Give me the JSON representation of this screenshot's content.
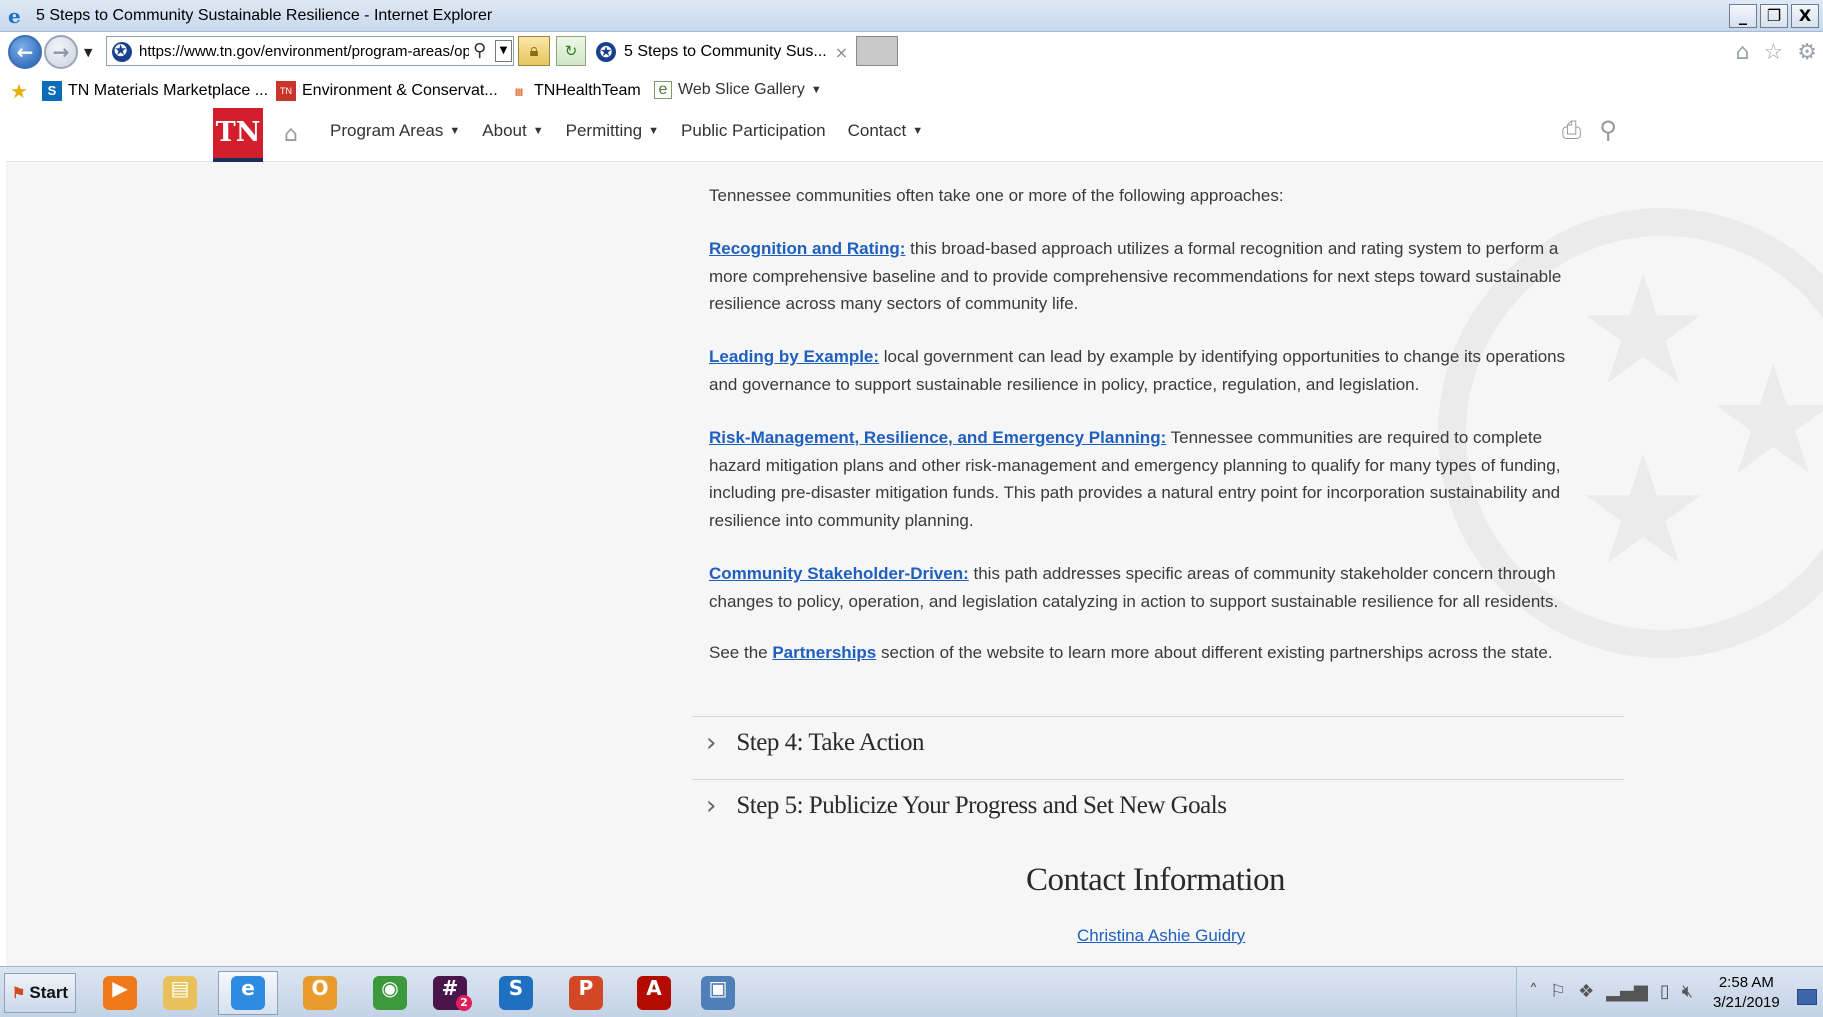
{
  "window": {
    "title": "5 Steps to Community Sustainable Resilience - Internet Explorer",
    "controls": [
      "_",
      "❐",
      "X"
    ]
  },
  "browser": {
    "url": "https://www.tn.gov/environment/program-areas/opsp-policy-and-sustainable-practices",
    "tab_label": "5 Steps to Community Sus...",
    "tab_close": "×"
  },
  "favorites": [
    {
      "label": "TN Materials Marketplace ...",
      "icon": "sp"
    },
    {
      "label": "Environment & Conservat...",
      "icon": "TN"
    },
    {
      "label": "TNHealthTeam",
      "icon": "ıııı"
    },
    {
      "label": "Web Slice Gallery",
      "icon": "e"
    }
  ],
  "site": {
    "logo": "TN",
    "nav": [
      {
        "label": "Program Areas",
        "has_caret": true
      },
      {
        "label": "About",
        "has_caret": true
      },
      {
        "label": "Permitting",
        "has_caret": true
      },
      {
        "label": "Public Participation",
        "has_caret": false
      },
      {
        "label": "Contact",
        "has_caret": true
      }
    ]
  },
  "content": {
    "intro": "Tennessee communities often take one or more of the following approaches:",
    "approaches": [
      {
        "link": "Recognition and Rating:",
        "text": " this broad-based approach utilizes a formal recognition and rating system to perform a more comprehensive baseline and to provide comprehensive recommendations for next steps toward sustainable resilience across many sectors of community life."
      },
      {
        "link": "Leading by Example:",
        "text": " local government can lead by example by identifying opportunities to change its operations and governance to support sustainable resilience in policy, practice, regulation, and legislation."
      },
      {
        "link": "Risk-Management, Resilience, and Emergency Planning:",
        "text": " Tennessee communities are required to complete hazard mitigation plans and other risk-management and emergency planning to qualify for many types of funding, including pre-disaster mitigation funds. This path provides a natural entry point for incorporation sustainability and resilience into community planning."
      },
      {
        "link": "Community Stakeholder-Driven:",
        "text": " this path addresses specific areas of community stakeholder concern through changes to policy, operation, and legislation catalyzing in action to support sustainable resilience for all residents."
      }
    ],
    "see_prefix": "See the ",
    "see_link": "Partnerships",
    "see_suffix": " section of the website to learn more about different existing partnerships across the state.",
    "steps": [
      "Step 4: Take Action",
      "Step 5: Publicize Your Progress and Set New Goals"
    ],
    "contact_heading": "Contact Information",
    "contact_name": "Christina Ashie Guidry"
  },
  "taskbar": {
    "start_label": "Start",
    "apps": [
      {
        "name": "media-player",
        "color": "#f07a1a",
        "glyph": "▶"
      },
      {
        "name": "file-explorer",
        "color": "#e8c15a",
        "glyph": "▤"
      },
      {
        "name": "internet-explorer",
        "color": "#2d8be0",
        "glyph": "e",
        "active": true
      },
      {
        "name": "outlook",
        "color": "#e89a2a",
        "glyph": "O"
      },
      {
        "name": "chrome",
        "color": "#3c9a3c",
        "glyph": "◉"
      },
      {
        "name": "slack",
        "color": "#4a154b",
        "glyph": "#",
        "badge": "2"
      },
      {
        "name": "skype-business",
        "color": "#1f70c1",
        "glyph": "S"
      },
      {
        "name": "powerpoint",
        "color": "#d24726",
        "glyph": "P"
      },
      {
        "name": "acrobat",
        "color": "#b30b00",
        "glyph": "A"
      },
      {
        "name": "photos",
        "color": "#4f7fb8",
        "glyph": "▣"
      }
    ],
    "time": "2:58 AM",
    "date": "3/21/2019"
  }
}
